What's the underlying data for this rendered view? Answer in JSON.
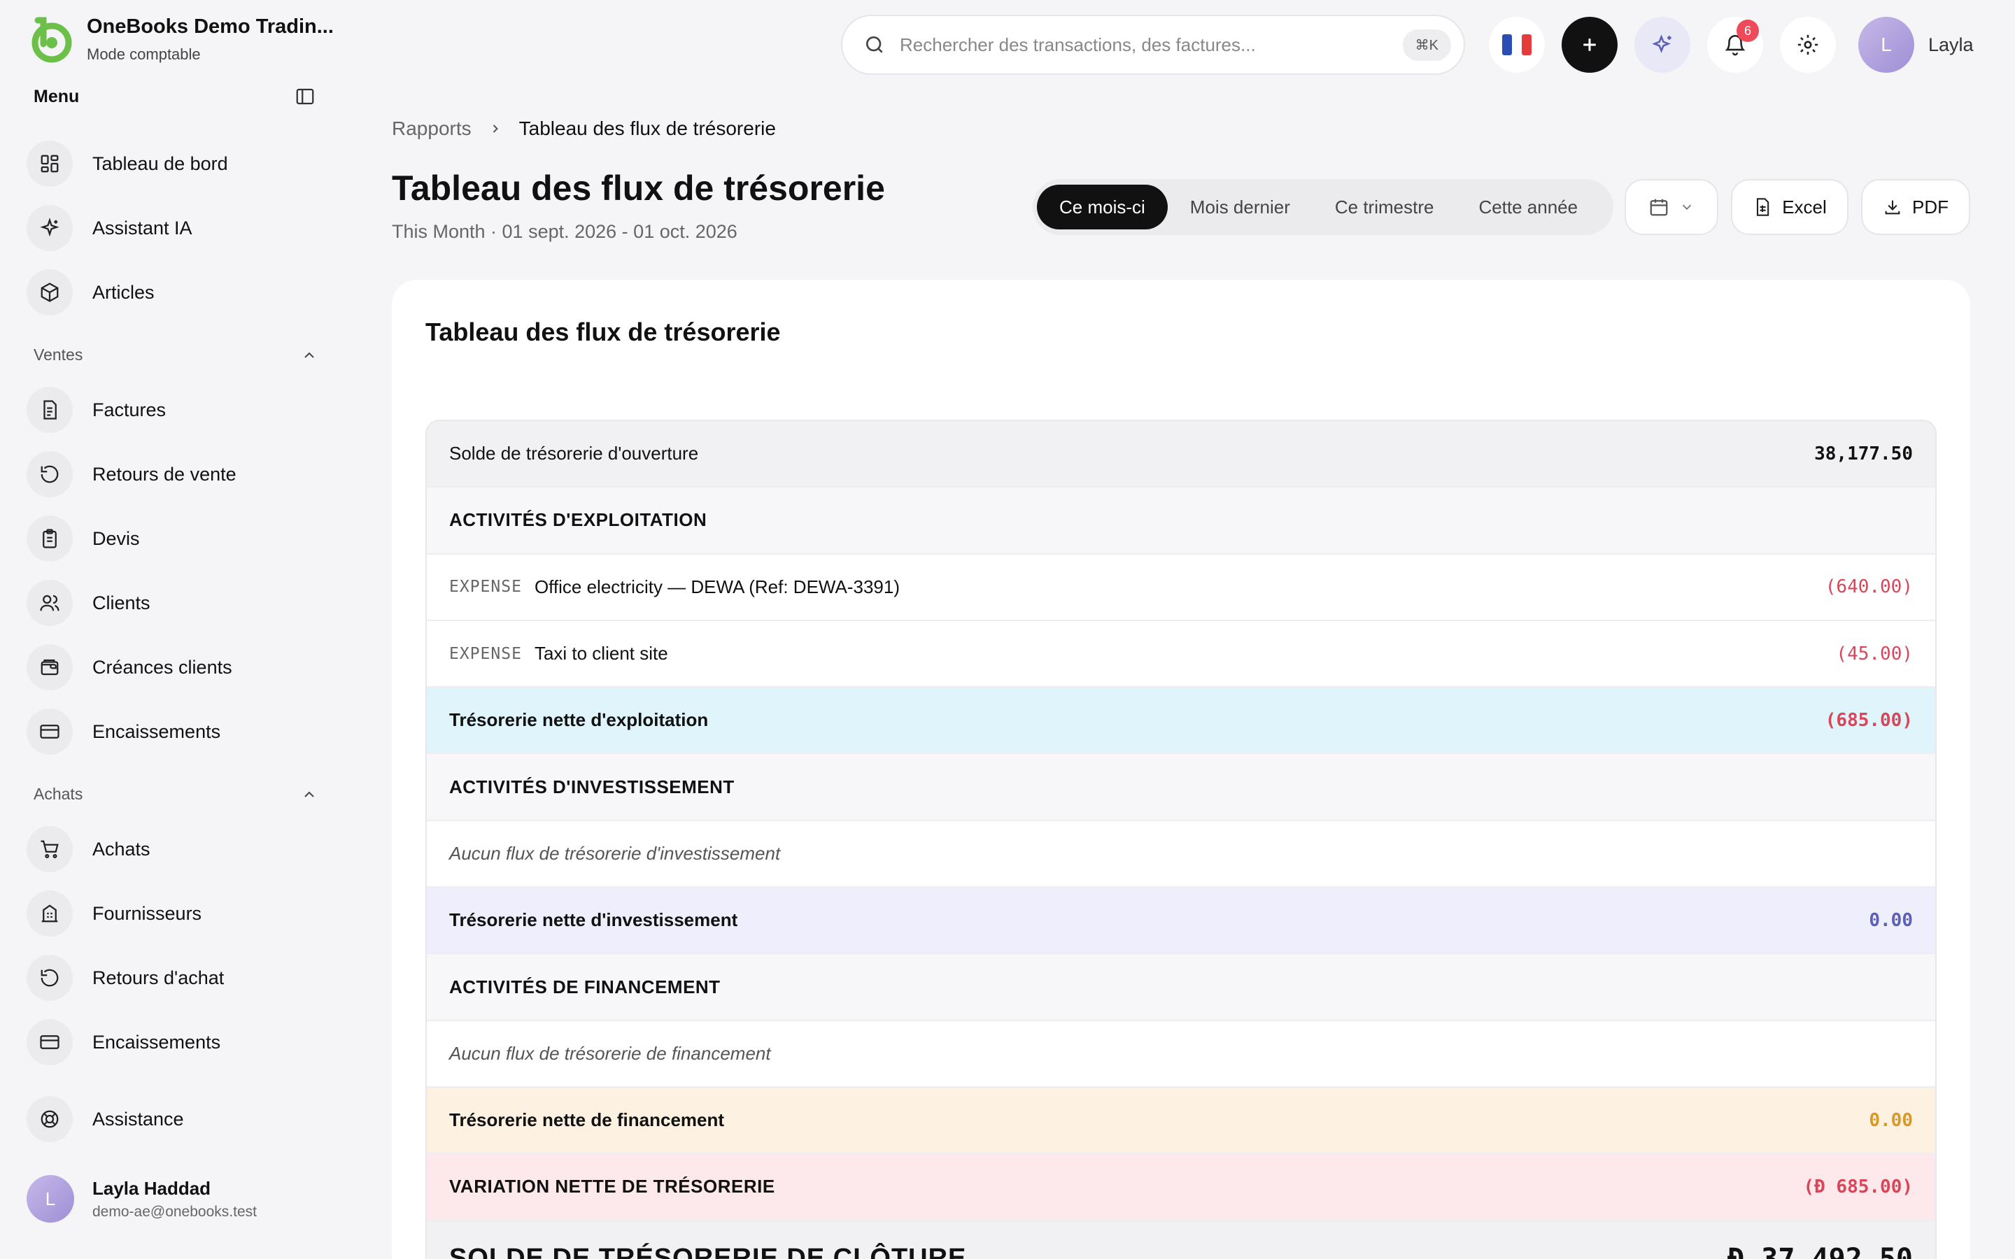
{
  "app": {
    "company_name": "OneBooks Demo Tradin...",
    "mode": "Mode comptable",
    "brand_color": "#6cc04a"
  },
  "sidebar": {
    "menu_title": "Menu",
    "top_items": [
      {
        "label": "Tableau de bord",
        "icon": "dashboard-icon"
      },
      {
        "label": "Assistant IA",
        "icon": "sparkles-icon"
      },
      {
        "label": "Articles",
        "icon": "package-icon"
      }
    ],
    "sales_section": "Ventes",
    "sales_items": [
      {
        "label": "Factures",
        "icon": "invoice-icon"
      },
      {
        "label": "Retours de vente",
        "icon": "return-icon"
      },
      {
        "label": "Devis",
        "icon": "clipboard-icon"
      },
      {
        "label": "Clients",
        "icon": "users-icon"
      },
      {
        "label": "Créances clients",
        "icon": "wallet-icon"
      },
      {
        "label": "Encaissements",
        "icon": "card-icon"
      }
    ],
    "purchases_section": "Achats",
    "purchase_items": [
      {
        "label": "Achats",
        "icon": "cart-icon"
      },
      {
        "label": "Fournisseurs",
        "icon": "building-icon"
      },
      {
        "label": "Retours d'achat",
        "icon": "return-icon"
      },
      {
        "label": "Encaissements",
        "icon": "card-icon"
      }
    ],
    "support_item": {
      "label": "Assistance",
      "icon": "lifebuoy-icon"
    },
    "user": {
      "initial": "L",
      "name": "Layla Haddad",
      "email": "demo-ae@onebooks.test"
    }
  },
  "topbar": {
    "search_placeholder": "Rechercher des transactions, des factures...",
    "search_shortcut": "⌘K",
    "language_flag": "FR",
    "notification_count": "6",
    "user_initial": "L",
    "user_name": "Layla"
  },
  "page": {
    "breadcrumb_parent": "Rapports",
    "breadcrumb_current": "Tableau des flux de trésorerie",
    "title": "Tableau des flux de trésorerie",
    "subtitle": "This Month · 01 sept. 2026 - 01 oct. 2026",
    "periods": [
      "Ce mois-ci",
      "Mois dernier",
      "Ce trimestre",
      "Cette année"
    ],
    "active_period": "Ce mois-ci",
    "excel_label": "Excel",
    "pdf_label": "PDF"
  },
  "report": {
    "card_title": "Tableau des flux de trésorerie",
    "opening_label": "Solde de trésorerie d'ouverture",
    "opening_amount": "38,177.50",
    "operating_header": "ACTIVITÉS D'EXPLOITATION",
    "operating_rows": [
      {
        "tag": "EXPENSE",
        "description": "Office electricity — DEWA (Ref: DEWA-3391)",
        "amount": "(640.00)"
      },
      {
        "tag": "EXPENSE",
        "description": "Taxi to client site",
        "amount": "(45.00)"
      }
    ],
    "operating_total_label": "Trésorerie nette d'exploitation",
    "operating_total": "(685.00)",
    "investing_header": "ACTIVITÉS D'INVESTISSEMENT",
    "investing_empty": "Aucun flux de trésorerie d'investissement",
    "investing_total_label": "Trésorerie nette d'investissement",
    "investing_total": "0.00",
    "financing_header": "ACTIVITÉS DE FINANCEMENT",
    "financing_empty": "Aucun flux de trésorerie de financement",
    "financing_total_label": "Trésorerie nette de financement",
    "financing_total": "0.00",
    "change_label": "VARIATION NETTE DE TRÉSORERIE",
    "change_currency": "Đ",
    "change_amount": "685.00",
    "closing_label": "SOLDE DE TRÉSORERIE DE CLÔTURE",
    "closing_currency": "Đ",
    "closing_amount": "37,492.50",
    "colors": {
      "negative": "#d9465a",
      "investing": "#5b5fb8",
      "financing": "#d99a24"
    }
  }
}
